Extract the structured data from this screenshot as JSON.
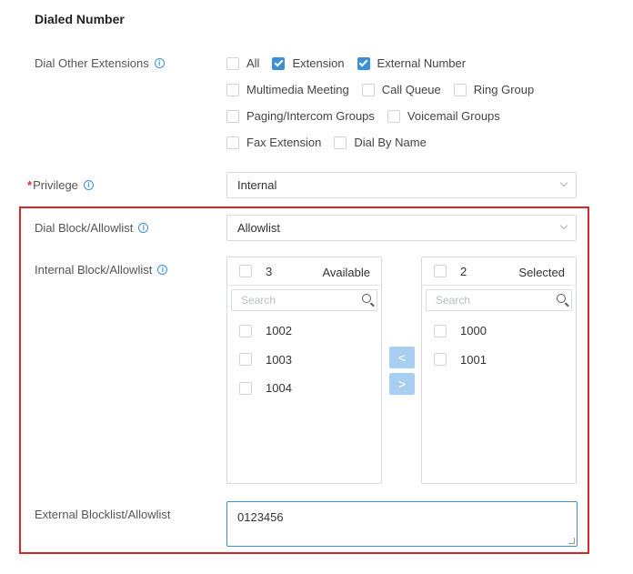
{
  "section_title": "Dialed Number",
  "dial_other_extensions": {
    "label": "Dial Other Extensions",
    "options": [
      [
        {
          "label": "All",
          "checked": false
        },
        {
          "label": "Extension",
          "checked": true
        },
        {
          "label": "External Number",
          "checked": true
        }
      ],
      [
        {
          "label": "Multimedia Meeting",
          "checked": false
        },
        {
          "label": "Call Queue",
          "checked": false
        },
        {
          "label": "Ring Group",
          "checked": false
        }
      ],
      [
        {
          "label": "Paging/Intercom Groups",
          "checked": false
        },
        {
          "label": "Voicemail Groups",
          "checked": false
        }
      ],
      [
        {
          "label": "Fax Extension",
          "checked": false
        },
        {
          "label": "Dial By Name",
          "checked": false
        }
      ]
    ]
  },
  "privilege": {
    "label": "Privilege",
    "value": "Internal"
  },
  "dial_block": {
    "label": "Dial Block/Allowlist",
    "value": "Allowlist"
  },
  "internal_block": {
    "label": "Internal Block/Allowlist",
    "available": {
      "count": "3",
      "title": "Available",
      "search_placeholder": "Search",
      "items": [
        "1002",
        "1003",
        "1004"
      ]
    },
    "selected": {
      "count": "2",
      "title": "Selected",
      "search_placeholder": "Search",
      "items": [
        "1000",
        "1001"
      ]
    },
    "move_left_icon": "<",
    "move_right_icon": ">"
  },
  "external_block": {
    "label": "External Blocklist/Allowlist",
    "value": "0123456"
  },
  "colors": {
    "accent": "#3b8ed8",
    "highlight_frame": "#d9262b",
    "arrow_button": "#a9cff0"
  }
}
